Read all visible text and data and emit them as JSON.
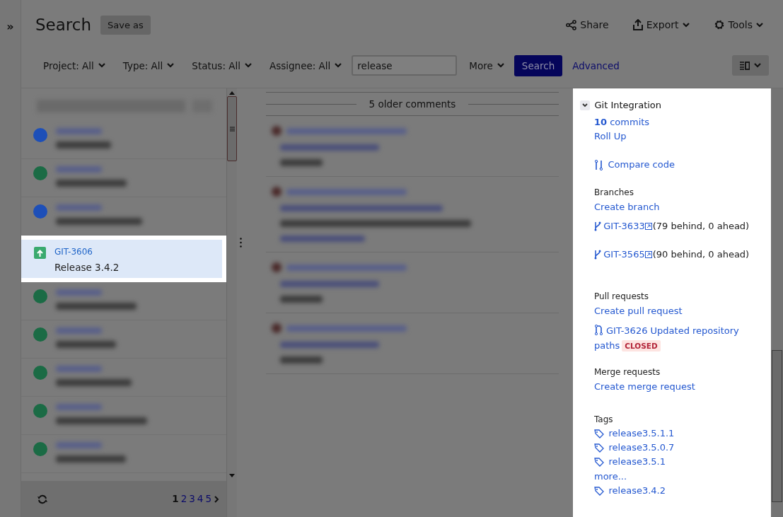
{
  "sidebar_toggle": "»",
  "page": {
    "title": "Search",
    "save_button": "Save as"
  },
  "actions": [
    {
      "kind": "share",
      "label": "Share",
      "dropdown": false
    },
    {
      "kind": "export",
      "label": "Export",
      "dropdown": true
    },
    {
      "kind": "tools",
      "label": "Tools",
      "dropdown": true
    }
  ],
  "filters": [
    {
      "label": "Project: All"
    },
    {
      "label": "Type: All"
    },
    {
      "label": "Status: All"
    },
    {
      "label": "Assignee: All"
    }
  ],
  "search": {
    "value": "release"
  },
  "more": "More",
  "search_button": "Search",
  "advanced": "Advanced",
  "issues": [
    {
      "kind": "blurred",
      "color": "#1d4fb8",
      "selected": false
    },
    {
      "kind": "blurred",
      "color": "#1b6b45",
      "selected": false
    },
    {
      "kind": "blurred",
      "color": "#1d4fb8",
      "selected": false
    },
    {
      "kind": "issue",
      "key": "GIT-3606",
      "summary": "Release 3.4.2",
      "selected": true
    },
    {
      "kind": "blurred",
      "color": "#1b6b45",
      "selected": false
    },
    {
      "kind": "blurred",
      "color": "#1b6b45",
      "selected": false
    },
    {
      "kind": "blurred",
      "color": "#1b6b45",
      "selected": false
    },
    {
      "kind": "blurred",
      "color": "#1b6b45",
      "selected": false
    },
    {
      "kind": "blurred",
      "color": "#1b6b45",
      "selected": false
    }
  ],
  "pagination": {
    "pages": [
      {
        "label": "1",
        "selected": true
      },
      {
        "label": "2",
        "selected": false
      },
      {
        "label": "3",
        "selected": false
      },
      {
        "label": "4",
        "selected": false
      },
      {
        "label": "5",
        "selected": false
      }
    ]
  },
  "comments": {
    "older": "5 older comments"
  },
  "git": {
    "title": "Git Integration",
    "expanded": true,
    "commits": "**10** commits",
    "roll_up": "Roll Up",
    "compare": "Compare code",
    "branches": {
      "heading": "Branches",
      "create": "Create branch",
      "items": [
        {
          "name": "GIT-3633",
          "status": "(79 behind, 0 ahead)"
        },
        {
          "name": "GIT-3565",
          "status": "(90 behind, 0 ahead)"
        }
      ]
    },
    "pull_requests": {
      "heading": "Pull requests",
      "create": "Create pull request",
      "items": [
        {
          "title": "GIT-3626 Updated repository paths",
          "status": "CLOSED"
        }
      ]
    },
    "merge_requests": {
      "heading": "Merge requests",
      "create": "Create merge request"
    },
    "tags": {
      "heading": "Tags",
      "items": [
        {
          "kind": "tag",
          "label": "release3.5.1.1"
        },
        {
          "kind": "tag",
          "label": "release3.5.0.7"
        },
        {
          "kind": "tag",
          "label": "release3.5.1"
        },
        {
          "kind": "more",
          "label": "more..."
        },
        {
          "kind": "tag",
          "label": "release3.4.2"
        }
      ]
    }
  }
}
